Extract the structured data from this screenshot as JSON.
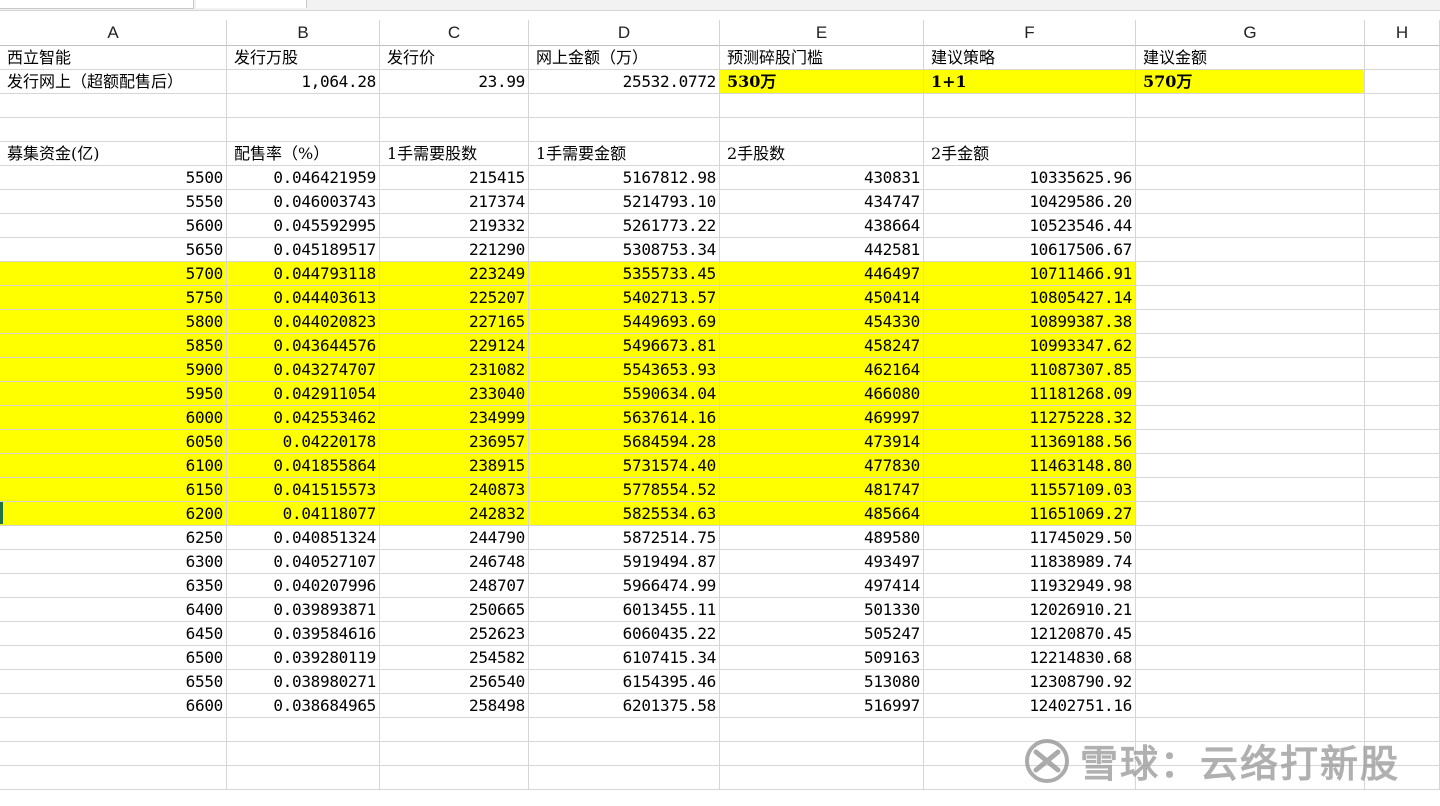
{
  "columns": [
    "A",
    "B",
    "C",
    "D",
    "E",
    "F",
    "G",
    "H"
  ],
  "summary_header": {
    "a": "西立智能",
    "b": "发行万股",
    "c": "发行价",
    "d": "网上金额（万）",
    "e": "预测碎股门槛",
    "f": "建议策略",
    "g": "建议金额"
  },
  "summary_values": {
    "a": "发行网上（超额配售后）",
    "b": "1,064.28",
    "c": "23.99",
    "d": "25532.0772",
    "e": "530万",
    "f": "1+1",
    "g": "570万"
  },
  "table_header": {
    "a": "募集资金(亿)",
    "b": "配售率（%）",
    "c": "1手需要股数",
    "d": "1手需要金额",
    "e": "2手股数",
    "f": "2手金额"
  },
  "rows": [
    {
      "a": "5500",
      "b": "0.046421959",
      "c": "215415",
      "d": "5167812.98",
      "e": "430831",
      "f": "10335625.96",
      "hl": false
    },
    {
      "a": "5550",
      "b": "0.046003743",
      "c": "217374",
      "d": "5214793.10",
      "e": "434747",
      "f": "10429586.20",
      "hl": false
    },
    {
      "a": "5600",
      "b": "0.045592995",
      "c": "219332",
      "d": "5261773.22",
      "e": "438664",
      "f": "10523546.44",
      "hl": false
    },
    {
      "a": "5650",
      "b": "0.045189517",
      "c": "221290",
      "d": "5308753.34",
      "e": "442581",
      "f": "10617506.67",
      "hl": false
    },
    {
      "a": "5700",
      "b": "0.044793118",
      "c": "223249",
      "d": "5355733.45",
      "e": "446497",
      "f": "10711466.91",
      "hl": true
    },
    {
      "a": "5750",
      "b": "0.044403613",
      "c": "225207",
      "d": "5402713.57",
      "e": "450414",
      "f": "10805427.14",
      "hl": true
    },
    {
      "a": "5800",
      "b": "0.044020823",
      "c": "227165",
      "d": "5449693.69",
      "e": "454330",
      "f": "10899387.38",
      "hl": true
    },
    {
      "a": "5850",
      "b": "0.043644576",
      "c": "229124",
      "d": "5496673.81",
      "e": "458247",
      "f": "10993347.62",
      "hl": true
    },
    {
      "a": "5900",
      "b": "0.043274707",
      "c": "231082",
      "d": "5543653.93",
      "e": "462164",
      "f": "11087307.85",
      "hl": true
    },
    {
      "a": "5950",
      "b": "0.042911054",
      "c": "233040",
      "d": "5590634.04",
      "e": "466080",
      "f": "11181268.09",
      "hl": true
    },
    {
      "a": "6000",
      "b": "0.042553462",
      "c": "234999",
      "d": "5637614.16",
      "e": "469997",
      "f": "11275228.32",
      "hl": true
    },
    {
      "a": "6050",
      "b": "0.04220178",
      "c": "236957",
      "d": "5684594.28",
      "e": "473914",
      "f": "11369188.56",
      "hl": true
    },
    {
      "a": "6100",
      "b": "0.041855864",
      "c": "238915",
      "d": "5731574.40",
      "e": "477830",
      "f": "11463148.80",
      "hl": true
    },
    {
      "a": "6150",
      "b": "0.041515573",
      "c": "240873",
      "d": "5778554.52",
      "e": "481747",
      "f": "11557109.03",
      "hl": true
    },
    {
      "a": "6200",
      "b": "0.04118077",
      "c": "242832",
      "d": "5825534.63",
      "e": "485664",
      "f": "11651069.27",
      "hl": true
    },
    {
      "a": "6250",
      "b": "0.040851324",
      "c": "244790",
      "d": "5872514.75",
      "e": "489580",
      "f": "11745029.50",
      "hl": false
    },
    {
      "a": "6300",
      "b": "0.040527107",
      "c": "246748",
      "d": "5919494.87",
      "e": "493497",
      "f": "11838989.74",
      "hl": false
    },
    {
      "a": "6350",
      "b": "0.040207996",
      "c": "248707",
      "d": "5966474.99",
      "e": "497414",
      "f": "11932949.98",
      "hl": false
    },
    {
      "a": "6400",
      "b": "0.039893871",
      "c": "250665",
      "d": "6013455.11",
      "e": "501330",
      "f": "12026910.21",
      "hl": false
    },
    {
      "a": "6450",
      "b": "0.039584616",
      "c": "252623",
      "d": "6060435.22",
      "e": "505247",
      "f": "12120870.45",
      "hl": false
    },
    {
      "a": "6500",
      "b": "0.039280119",
      "c": "254582",
      "d": "6107415.34",
      "e": "509163",
      "f": "12214830.68",
      "hl": false
    },
    {
      "a": "6550",
      "b": "0.038980271",
      "c": "256540",
      "d": "6154395.46",
      "e": "513080",
      "f": "12308790.92",
      "hl": false
    },
    {
      "a": "6600",
      "b": "0.038684965",
      "c": "258498",
      "d": "6201375.58",
      "e": "516997",
      "f": "12402751.16",
      "hl": false
    }
  ],
  "highlight_color": "#ffff00",
  "watermark": {
    "text": "雪球：云络打新股",
    "icon": "xueqiu-logo-icon"
  }
}
